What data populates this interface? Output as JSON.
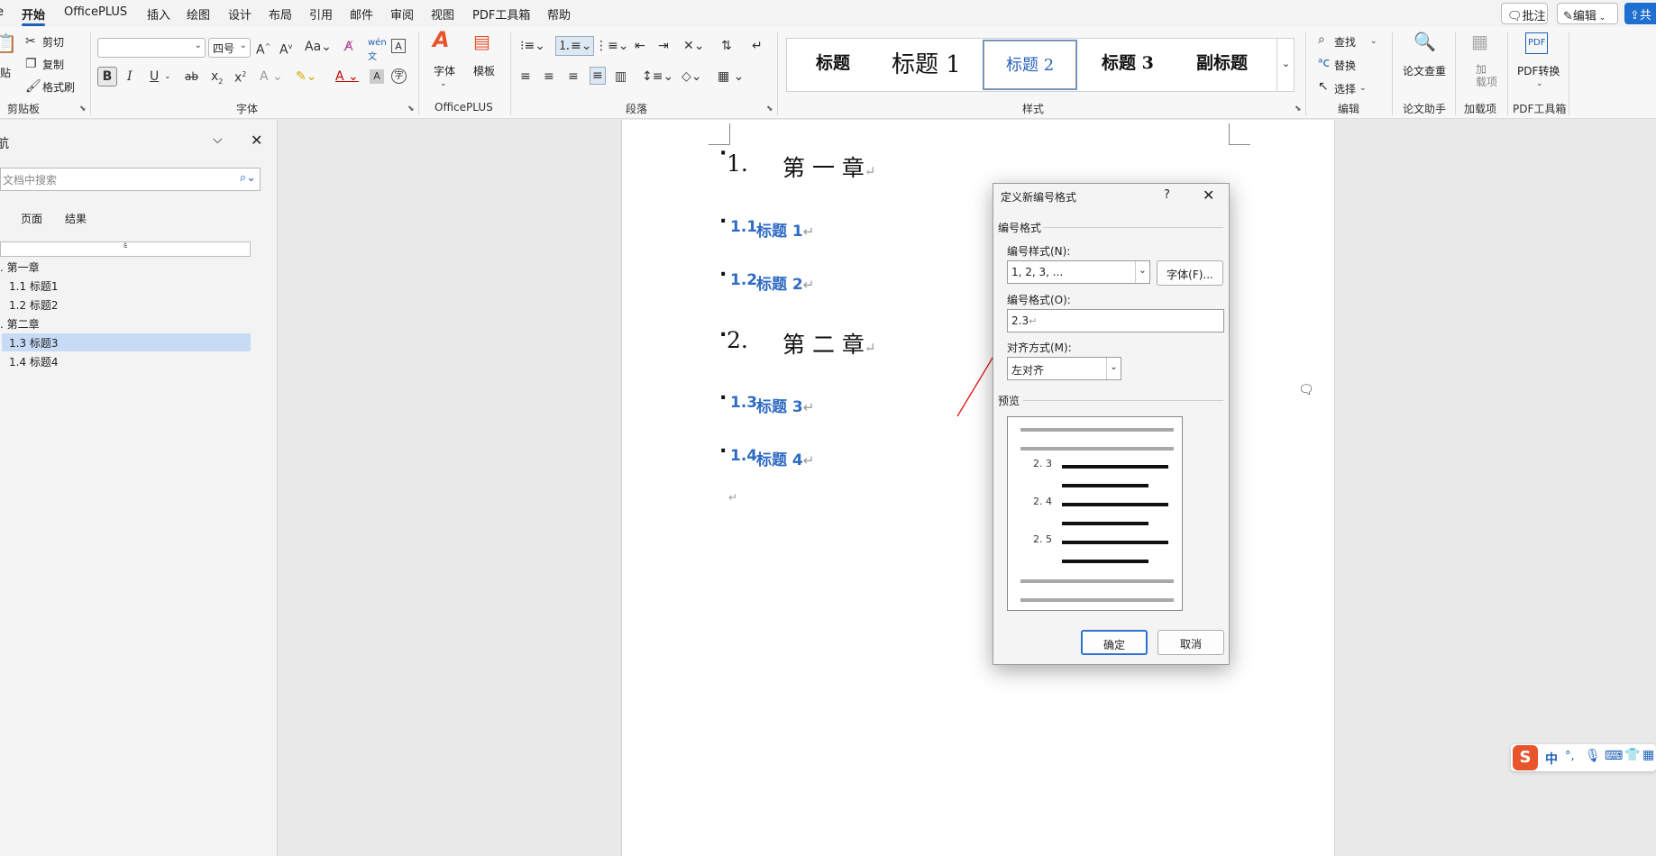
{
  "menubar": {
    "tabs": [
      "开始",
      "OfficePLUS",
      "插入",
      "绘图",
      "设计",
      "布局",
      "引用",
      "邮件",
      "审阅",
      "视图",
      "PDF工具箱",
      "帮助"
    ],
    "comment_btn": "批注",
    "edit_btn": "编辑",
    "share_btn": "共"
  },
  "ribbon": {
    "clipboard": {
      "paste": "贴",
      "cut": "剪切",
      "copy": "复制",
      "format_painter": "格式刷",
      "label": "剪贴板"
    },
    "font": {
      "font_name": "",
      "font_size": "四号",
      "label": "字体",
      "bold": "B",
      "italic": "I",
      "underline": "U"
    },
    "officeplus": {
      "font": "字体",
      "template": "模板",
      "label": "OfficePLUS"
    },
    "paragraph": {
      "label": "段落"
    },
    "styles": {
      "items": [
        "标题",
        "标题 1",
        "标题 2",
        "标题 3",
        "副标题"
      ],
      "selected": "标题 2",
      "label": "样式"
    },
    "editing": {
      "find": "查找",
      "replace": "替换",
      "select": "选择",
      "label": "编辑"
    },
    "paper": {
      "check": "论文查重",
      "label": "论文助手"
    },
    "addins": {
      "btn": "加\n载项",
      "label": "加载项"
    },
    "pdf": {
      "btn": "PDF转换",
      "label": "PDF工具箱"
    }
  },
  "navpane": {
    "title": "航",
    "search_placeholder": "文档中搜索",
    "tabs": [
      "页面",
      "结果"
    ],
    "items": [
      {
        "label": ". 第一章",
        "level": 1
      },
      {
        "label": "1.1 标题1",
        "level": 2
      },
      {
        "label": "1.2 标题2",
        "level": 2
      },
      {
        "label": ". 第二章",
        "level": 1
      },
      {
        "label": "1.3 标题3",
        "level": 2,
        "selected": true
      },
      {
        "label": "1.4 标题4",
        "level": 2
      }
    ]
  },
  "document": {
    "headings": [
      {
        "num": "1.",
        "text": "第 一 章",
        "kind": "h1"
      },
      {
        "num": "1.1",
        "text": "标题 1",
        "kind": "h2"
      },
      {
        "num": "1.2",
        "text": "标题 2",
        "kind": "h2"
      },
      {
        "num": "2.",
        "text": "第 二 章",
        "kind": "h1"
      },
      {
        "num": "1.3",
        "text": "标题 3",
        "kind": "h2"
      },
      {
        "num": "1.4",
        "text": "标题 4",
        "kind": "h2"
      }
    ],
    "para_mark": "↵"
  },
  "dialog": {
    "title": "定义新编号格式",
    "help": "?",
    "section_number_format": "编号格式",
    "number_style_label": "编号样式(N):",
    "number_style_value": "1, 2, 3, ...",
    "font_btn": "字体(F)...",
    "number_format_label": "编号格式(O):",
    "number_format_value": "2.3",
    "alignment_label": "对齐方式(M):",
    "alignment_value": "左对齐",
    "preview_label": "预览",
    "preview_numbers": [
      "2. 3",
      "2. 4",
      "2. 5"
    ],
    "ok": "确定",
    "cancel": "取消"
  },
  "ime": {
    "lang": "中"
  },
  "colors": {
    "accent": "#1e5fb8",
    "heading2": "#2f6bc4",
    "annotation": "#e02020",
    "selection": "#c7dbf6"
  }
}
